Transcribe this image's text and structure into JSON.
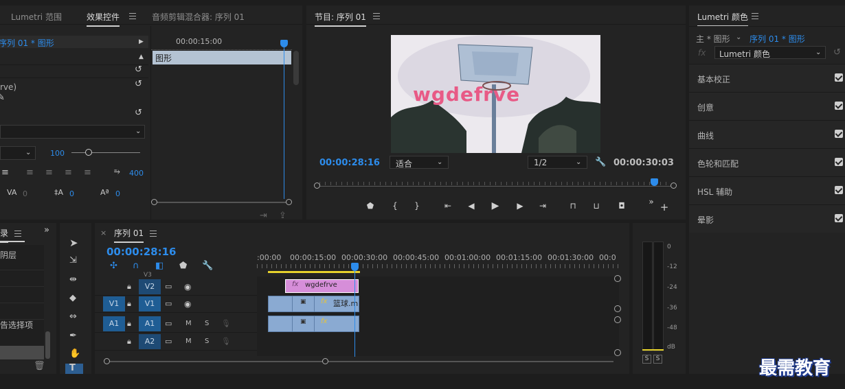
{
  "left_panel": {
    "tabs": [
      "Lumetri 范围",
      "效果控件",
      "音频剪辑混合器: 序列 01"
    ],
    "clip_path": "序列 01 * 图形",
    "timecode": "00:00:15:00",
    "layer_label": "图形",
    "partial_text": "rve)",
    "opacity_value": "100",
    "tracking_value": "400",
    "kerning_value": "0",
    "leading_value": "0",
    "baseline_value": "0"
  },
  "program_monitor": {
    "title": "节目: 序列 01",
    "video_text": "wgdefrve",
    "current_time": "00:00:28:16",
    "fit": "适合",
    "resolution": "1/2",
    "duration": "00:00:30:03"
  },
  "lumetri": {
    "title": "Lumetri 颜色",
    "source": "主 * 图形",
    "sequence": "序列 01 * 图形",
    "effect": "Lumetri 颜色",
    "sections": [
      "基本校正",
      "创意",
      "曲线",
      "色轮和匹配",
      "HSL 辅助",
      "晕影"
    ]
  },
  "project_panel": {
    "tab": "录",
    "items": [
      "阴层",
      "告选择项"
    ]
  },
  "timeline": {
    "title": "序列 01",
    "timecode": "00:00:28:16",
    "ruler": [
      ":00:00",
      "00:00:15:00",
      "00:00:30:00",
      "00:00:45:00",
      "00:01:00:00",
      "00:01:15:00",
      "00:01:30:00",
      "00:0"
    ],
    "tracks": [
      {
        "src": "",
        "name": "V2"
      },
      {
        "src": "V1",
        "name": "V1"
      },
      {
        "src": "A1",
        "name": "A1"
      },
      {
        "src": "",
        "name": "A2"
      }
    ],
    "clip_title": "wgdefrve",
    "clip_video": "篮球.m",
    "mute": "M",
    "solo": "S",
    "v3": "V3"
  },
  "meter": {
    "scale": [
      "0",
      "-12",
      "-24",
      "-36",
      "-48",
      "dB"
    ],
    "solo": "S"
  },
  "watermark": "最需教育"
}
